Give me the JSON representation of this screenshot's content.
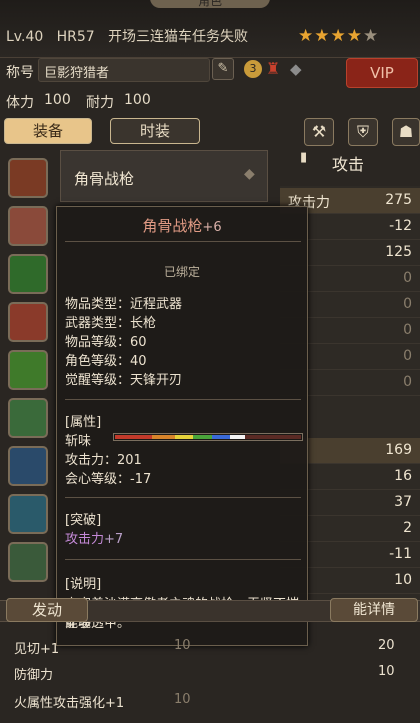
{
  "header": {
    "title_partial": "角色",
    "level": "Lv.40",
    "hr": "HR57",
    "status": "开场三连猫车任务失败",
    "stars_filled": 4,
    "stars_total": 5
  },
  "profile": {
    "title_label": "称号",
    "title_value": "巨影狩猎者",
    "stamina_label": "体力",
    "stamina_value": "100",
    "endurance_label": "耐力",
    "endurance_value": "100",
    "badge_number": "3",
    "vip_label": "VIP"
  },
  "tabs": {
    "equip": "装备",
    "fashion": "时装"
  },
  "right_panel": {
    "header": "攻击",
    "attack_label": "攻击力",
    "values": [
      "275",
      "-12",
      "125",
      "0",
      "0",
      "0",
      "0",
      "0",
      "169",
      "16",
      "37",
      "2",
      "-11",
      "10"
    ]
  },
  "equipped_weapon": "角骨战枪",
  "tooltip": {
    "name": "角骨战枪",
    "refine": "+6",
    "bound": "已绑定",
    "item_type_label": "物品类型：",
    "item_type": "近程武器",
    "weapon_type_label": "武器类型：",
    "weapon_type": "长枪",
    "item_level_label": "物品等级：",
    "item_level": "60",
    "char_level_label": "角色等级：",
    "char_level": "40",
    "awaken_label": "觉醒等级：",
    "awaken": "天锋开刃",
    "attr_header": "[属性]",
    "sharpness_label": "斩味",
    "attack_label": "攻击力：",
    "attack_value": "201",
    "crit_label": "会心等级：",
    "crit_value": "-17",
    "break_header": "[突破]",
    "break_stat": "攻击力",
    "break_value": "+7",
    "desc_header": "[说明]",
    "desc_line1": "寄宿着沙漠高傲者之魂的战枪，无坚不摧能够",
    "desc_line2": "穿魂透甲。"
  },
  "bottom": {
    "skill_tab": "发动",
    "detail_btn": "能详情",
    "rows": [
      {
        "label": "见切+1",
        "value": "10",
        "r_value": "20"
      },
      {
        "label": "防御力",
        "value": "",
        "r_value": "10"
      },
      {
        "label": "火属性攻击强化+1",
        "value": "10",
        "r_value": ""
      }
    ]
  }
}
